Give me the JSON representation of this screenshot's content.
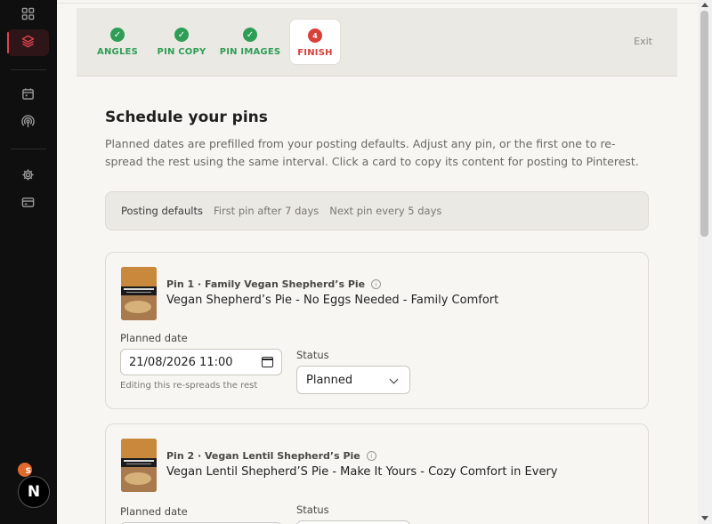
{
  "sidebar": {
    "items": [
      {
        "icon": "dashboard-icon"
      },
      {
        "icon": "layers-icon",
        "active": true
      },
      {
        "icon": "calendar-icon"
      },
      {
        "icon": "broadcast-icon"
      },
      {
        "icon": "gear-icon"
      },
      {
        "icon": "card-icon"
      }
    ],
    "user_initial": "S",
    "logo_letter": "N"
  },
  "stepper": {
    "steps": [
      {
        "label": "ANGLES",
        "state": "done",
        "marker": "✓"
      },
      {
        "label": "PIN COPY",
        "state": "done",
        "marker": "✓"
      },
      {
        "label": "PIN IMAGES",
        "state": "done",
        "marker": "✓"
      },
      {
        "label": "FINISH",
        "state": "current",
        "marker": "4"
      }
    ],
    "exit_label": "Exit"
  },
  "page": {
    "title": "Schedule your pins",
    "description": "Planned dates are prefilled from your posting defaults. Adjust any pin, or the first one to re-spread the rest using the same interval. Click a card to copy its content for posting to Pinterest."
  },
  "defaults": {
    "label": "Posting defaults",
    "first_pin": "First pin after 7 days",
    "next_pin": "Next pin every 5 days"
  },
  "pins": [
    {
      "meta": "Pin 1 · Family Vegan Shepherd’s Pie",
      "title": "Vegan Shepherd’s Pie - No Eggs Needed - Family Comfort",
      "date_label": "Planned date",
      "date_value": "21/08/2026 11:00",
      "hint": "Editing this re-spreads the rest",
      "status_label": "Status",
      "status_value": "Planned"
    },
    {
      "meta": "Pin 2 · Vegan Lentil Shepherd’s Pie",
      "title": "Vegan Lentil Shepherd’S Pie - Make It Yours - Cozy Comfort in Every",
      "date_label": "Planned date",
      "status_label": "Status"
    }
  ],
  "colors": {
    "success": "#2e9e57",
    "accent": "#d9403a",
    "sidebar_bg": "#0f0f0f",
    "main_bg": "#f7f6f2"
  }
}
